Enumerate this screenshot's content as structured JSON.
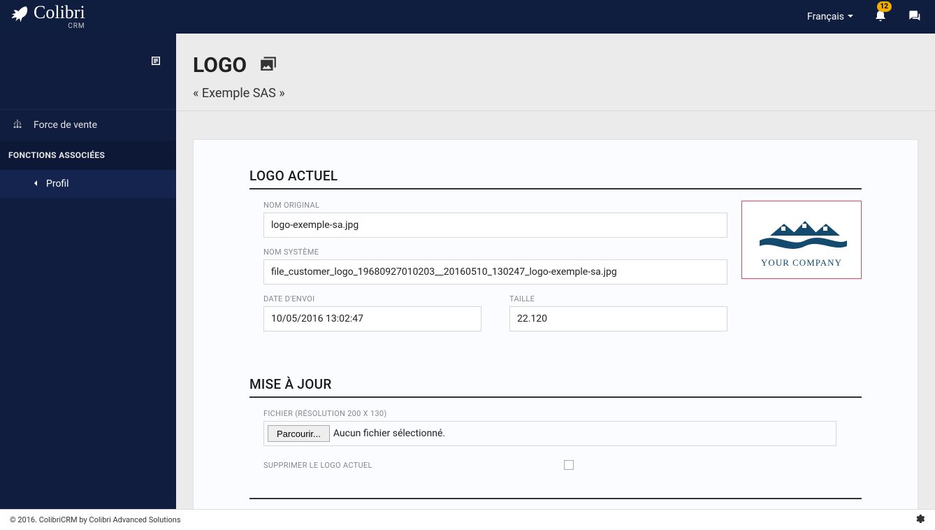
{
  "brand": {
    "name": "Colibri",
    "sub": "CRM"
  },
  "nav": {
    "language": "Français",
    "notifications_count": "12"
  },
  "sidebar": {
    "items": [
      {
        "label": "Force de vente"
      }
    ],
    "section": "FONCTIONS ASSOCIÉES",
    "sub": [
      {
        "label": "Profil"
      }
    ]
  },
  "page": {
    "title": "LOGO",
    "subtitle": "« Exemple SAS »"
  },
  "logo_section": {
    "title": "LOGO ACTUEL",
    "original_label": "NOM ORIGINAL",
    "original_value": "logo-exemple-sa.jpg",
    "system_label": "NOM SYSTÈME",
    "system_value": "file_customer_logo_19680927010203__20160510_130247_logo-exemple-sa.jpg",
    "date_label": "DATE D'ENVOI",
    "date_value": "10/05/2016 13:02:47",
    "size_label": "TAILLE",
    "size_value": "22.120",
    "preview_text": "YOUR COMPANY"
  },
  "update_section": {
    "title": "MISE À JOUR",
    "file_label": "FICHIER (RÉSOLUTION 200 X 130)",
    "browse": "Parcourir...",
    "no_file": "Aucun fichier sélectionné.",
    "delete_label": "SUPPRIMER LE LOGO ACTUEL"
  },
  "footer": {
    "text": "© 2016. ColibriCRM by Colibri Advanced Solutions"
  }
}
